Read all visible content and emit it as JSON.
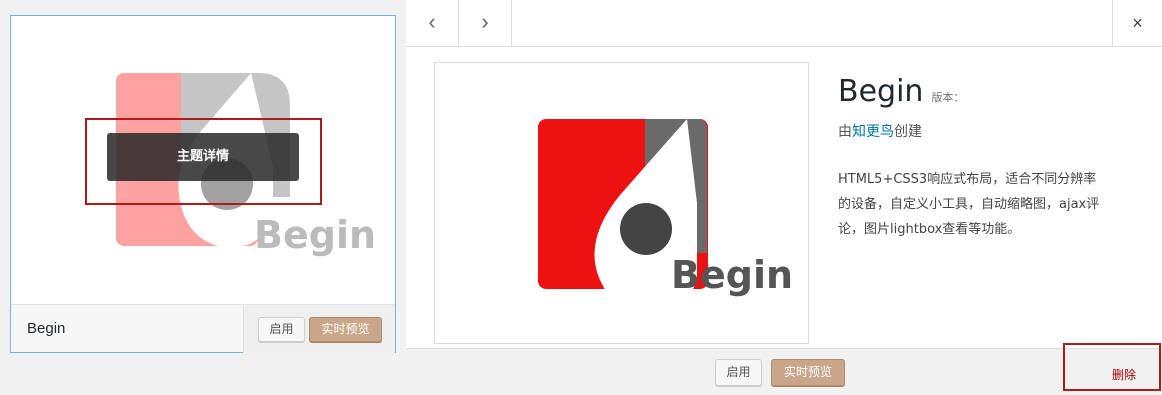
{
  "theme_card": {
    "name": "Begin",
    "details_label": "主题详情",
    "activate_label": "启用",
    "preview_label": "实时预览",
    "logo_text": "Begin"
  },
  "details": {
    "nav_prev": "‹",
    "nav_next": "›",
    "close": "×",
    "title": "Begin",
    "version_label": "版本：",
    "author_prefix": "由",
    "author_name": "知更鸟",
    "author_suffix": "创建",
    "description": "HTML5+CSS3响应式布局，适合不同分辨率的设备，自定义小工具，自动缩略图，ajax评论，图片lightbox查看等功能。",
    "logo_text": "Begin",
    "activate_label": "启用",
    "preview_label": "实时预览",
    "delete_label": "删除"
  },
  "colors": {
    "accent_link": "#0073aa",
    "preview_button": "#c9a58a",
    "delete_link": "#aa0000",
    "highlight_box": "#b01a1a",
    "logo_red": "#ee1111",
    "logo_grey": "#666666"
  }
}
